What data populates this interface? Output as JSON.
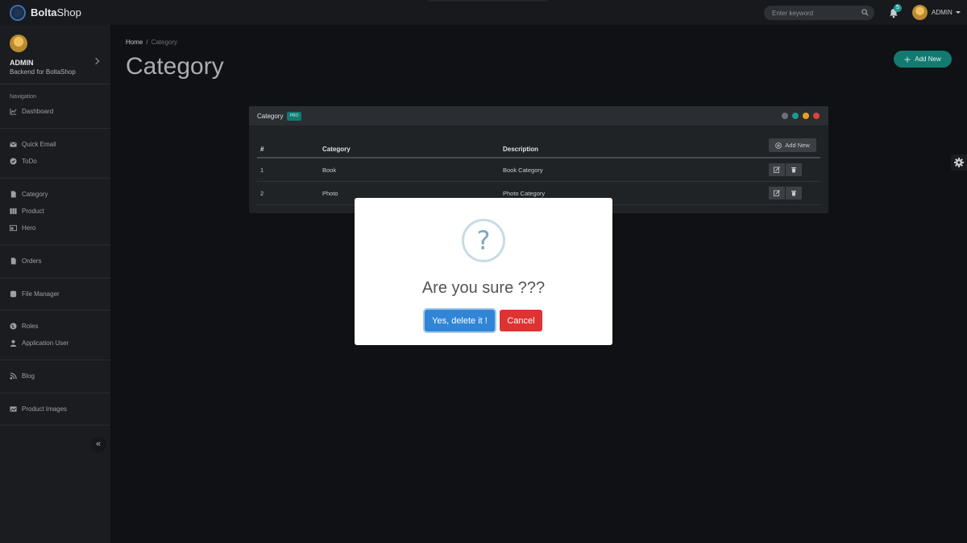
{
  "topbar": {
    "brand_bold": "Bolta",
    "brand_rest": "Shop",
    "search_placeholder": "Enter keyword",
    "notification_count": "5",
    "user_label": "ADMIN"
  },
  "sidebar": {
    "profile_name": "ADMIN",
    "profile_sub": "Backend for BoltaShop",
    "nav_heading": "Navigation",
    "items": [
      {
        "label": "Dashboard",
        "icon": "chart-line-icon"
      },
      {
        "label": "Quick Email",
        "icon": "envelope-icon"
      },
      {
        "label": "ToDo",
        "icon": "check-circle-icon"
      },
      {
        "label": "Category",
        "icon": "file-icon"
      },
      {
        "label": "Product",
        "icon": "columns-icon"
      },
      {
        "label": "Hero",
        "icon": "image-icon"
      },
      {
        "label": "Orders",
        "icon": "file-icon"
      },
      {
        "label": "File Manager",
        "icon": "database-icon"
      },
      {
        "label": "Roles",
        "icon": "globe-icon"
      },
      {
        "label": "Application User",
        "icon": "user-icon"
      },
      {
        "label": "Blog",
        "icon": "blog-icon"
      },
      {
        "label": "Product Images",
        "icon": "image-icon"
      }
    ],
    "collapse_glyph": "«"
  },
  "main": {
    "breadcrumb": {
      "home": "Home",
      "sep": "/",
      "current": "Category"
    },
    "title": "Category",
    "add_new_label": "Add New"
  },
  "panel": {
    "title": "Category",
    "badge": "PRO",
    "add_new_label": "Add New",
    "columns": [
      "#",
      "Category",
      "Description"
    ],
    "rows": [
      {
        "id": "1",
        "category": "Book",
        "description": "Book Category"
      },
      {
        "id": "2",
        "category": "Photo",
        "description": "Photo Category"
      }
    ],
    "control_colors": [
      "#6c7176",
      "#1a9a8f",
      "#e6a11a",
      "#d9453d"
    ]
  },
  "modal": {
    "icon_glyph": "?",
    "title": "Are you sure ???",
    "confirm_label": "Yes, delete it !",
    "cancel_label": "Cancel"
  },
  "colors": {
    "accent_teal": "#137a72",
    "confirm_blue": "#3085d6",
    "cancel_red": "#dd3333"
  }
}
